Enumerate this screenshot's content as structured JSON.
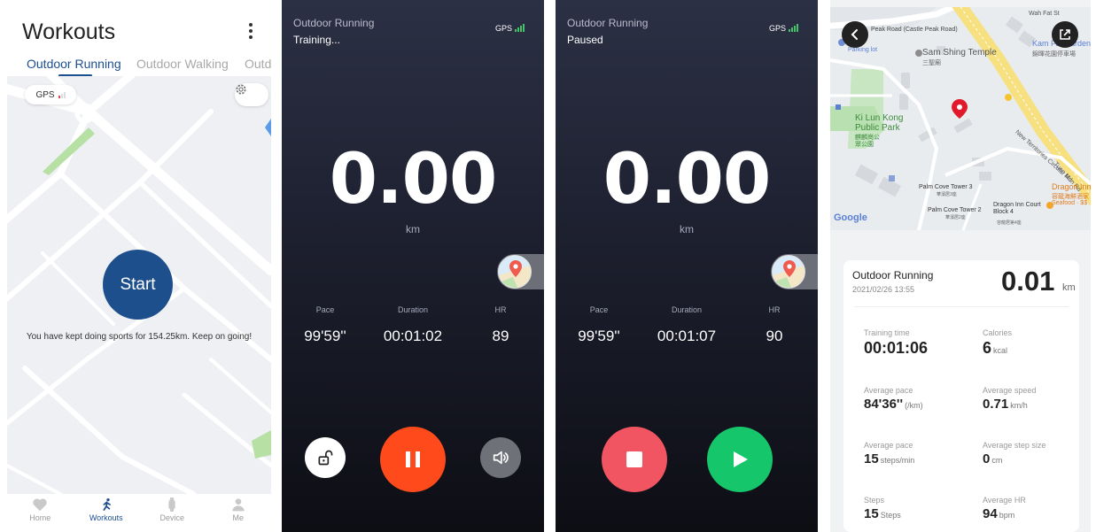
{
  "workouts": {
    "title": "Workouts",
    "tabs": [
      "Outdoor Running",
      "Outdoor Walking",
      "Outd"
    ],
    "gps_label": "GPS",
    "start_label": "Start",
    "message": "You have kept doing sports for 154.25km. Keep on going!",
    "nav": [
      {
        "label": "Home",
        "icon": "heart-icon"
      },
      {
        "label": "Workouts",
        "icon": "runner-icon"
      },
      {
        "label": "Device",
        "icon": "watch-icon"
      },
      {
        "label": "Me",
        "icon": "person-icon"
      }
    ],
    "accent": "#1d4f8d"
  },
  "training": {
    "sport": "Outdoor Running",
    "state": "Training...",
    "gps_label": "GPS",
    "distance": "0.00",
    "unit": "km",
    "stats": [
      {
        "label": "Pace",
        "value": "99'59''"
      },
      {
        "label": "Duration",
        "value": "00:01:02"
      },
      {
        "label": "HR",
        "value": "89"
      }
    ],
    "buttons": {
      "lock": "lock-icon",
      "pause": "pause-icon",
      "sound": "speaker-icon"
    },
    "pause_color": "#ff4a1c"
  },
  "paused": {
    "sport": "Outdoor Running",
    "state": "Paused",
    "gps_label": "GPS",
    "distance": "0.00",
    "unit": "km",
    "stats": [
      {
        "label": "Pace",
        "value": "99'59''"
      },
      {
        "label": "Duration",
        "value": "00:01:07"
      },
      {
        "label": "HR",
        "value": "90"
      }
    ],
    "buttons": {
      "stop": "stop-icon",
      "resume": "play-icon"
    },
    "stop_color": "#f25562",
    "resume_color": "#15c66b"
  },
  "summary": {
    "map_labels": {
      "castle_peak_road": "Peak Road (Castle Peak Road)",
      "parking": "Parking lot",
      "temple": "Sam Shing Temple",
      "temple_zh": "三聖廟",
      "wah_fat": "Wah Fat St",
      "kam_fai": "Kam Fai Garden Estate",
      "kam_fai_zh": "錦暉花園停車場",
      "park": "Ki Lun Kong Public Park",
      "park_zh": "麒麟崗公眾公園",
      "tuen_mun": "New Territories Circular Rd",
      "tuen_mun_rd": "Tuen Mun Rd",
      "tower3": "Palm Cove Tower 3",
      "tower3_zh": "華濱居3座",
      "tower2": "Palm Cove Tower 2",
      "tower2_zh": "華濱居2座",
      "dragon_block": "Dragon Inn Court Block 4",
      "dragon_block_zh": "容龍居第4座",
      "dragon_inn": "Dragon Inn",
      "dragon_inn2": "Dragon Inn",
      "dragon_zh": "容龍海鮮酒家",
      "seafood": "Seafood · $$",
      "google": "Google"
    },
    "sport": "Outdoor Running",
    "date": "2021/02/26 13:55",
    "distance": "0.01",
    "distance_unit": "km",
    "metrics": [
      {
        "label": "Training time",
        "value": "00:01:06",
        "unit": ""
      },
      {
        "label": "Calories",
        "value": "6",
        "unit": "kcal"
      },
      {
        "label": "Average pace",
        "value": "84'36''",
        "unit": "(/km)"
      },
      {
        "label": "Average speed",
        "value": "0.71",
        "unit": "km/h"
      },
      {
        "label": "Average pace",
        "value": "15",
        "unit": "steps/min"
      },
      {
        "label": "Average step size",
        "value": "0",
        "unit": "cm"
      },
      {
        "label": "Steps",
        "value": "15",
        "unit": "Steps"
      },
      {
        "label": "Average HR",
        "value": "94",
        "unit": "bpm"
      }
    ]
  }
}
